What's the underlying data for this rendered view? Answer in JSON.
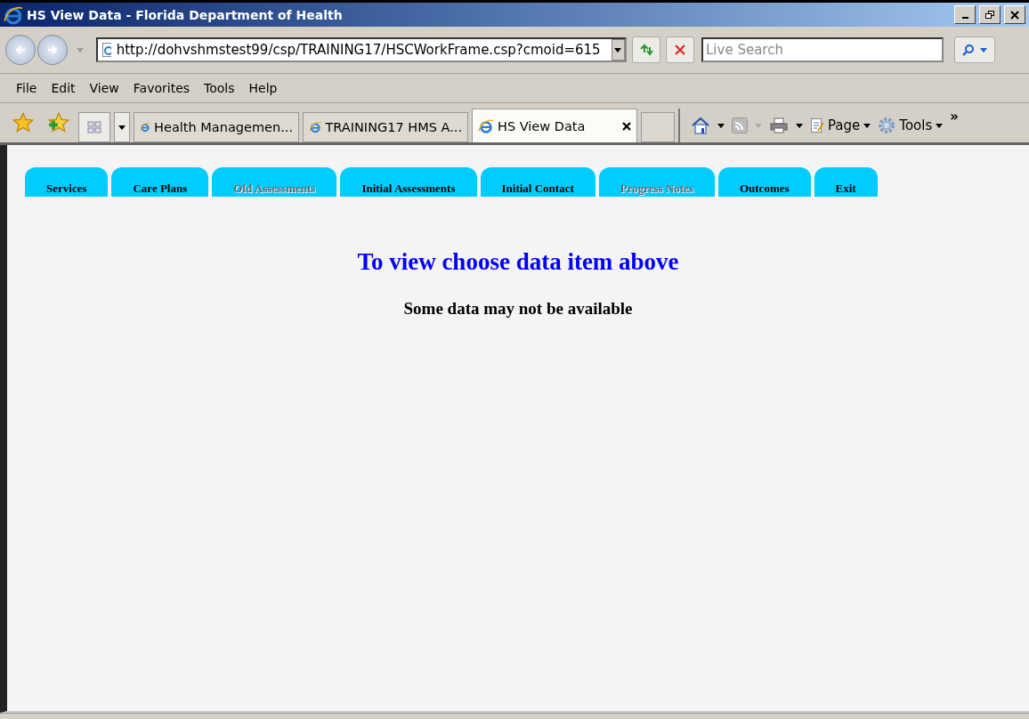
{
  "window": {
    "title": "HS View Data - Florida Department of Health"
  },
  "address": {
    "url": "http://dohvshmstest99/csp/TRAINING17/HSCWorkFrame.csp?cmoid=615"
  },
  "search": {
    "placeholder": "Live Search"
  },
  "menu": [
    "File",
    "Edit",
    "View",
    "Favorites",
    "Tools",
    "Help"
  ],
  "browser_tabs": [
    {
      "label": "Health Managemen...",
      "selected": false
    },
    {
      "label": "TRAINING17 HMS A...",
      "selected": false
    },
    {
      "label": "HS View Data",
      "selected": true
    }
  ],
  "command_bar": {
    "page": "Page",
    "tools": "Tools",
    "more": "»"
  },
  "page_tabs": [
    {
      "label": "Services",
      "disabled": false
    },
    {
      "label": "Care Plans",
      "disabled": false
    },
    {
      "label": "Old Assessments",
      "disabled": true
    },
    {
      "label": "Initial Assessments",
      "disabled": false
    },
    {
      "label": "Initial Contact",
      "disabled": false
    },
    {
      "label": "Progress Notes",
      "disabled": true
    },
    {
      "label": "Outcomes",
      "disabled": false
    },
    {
      "label": "Exit",
      "disabled": false
    }
  ],
  "heading": "To view choose data item above",
  "note": "Some data may not be available"
}
